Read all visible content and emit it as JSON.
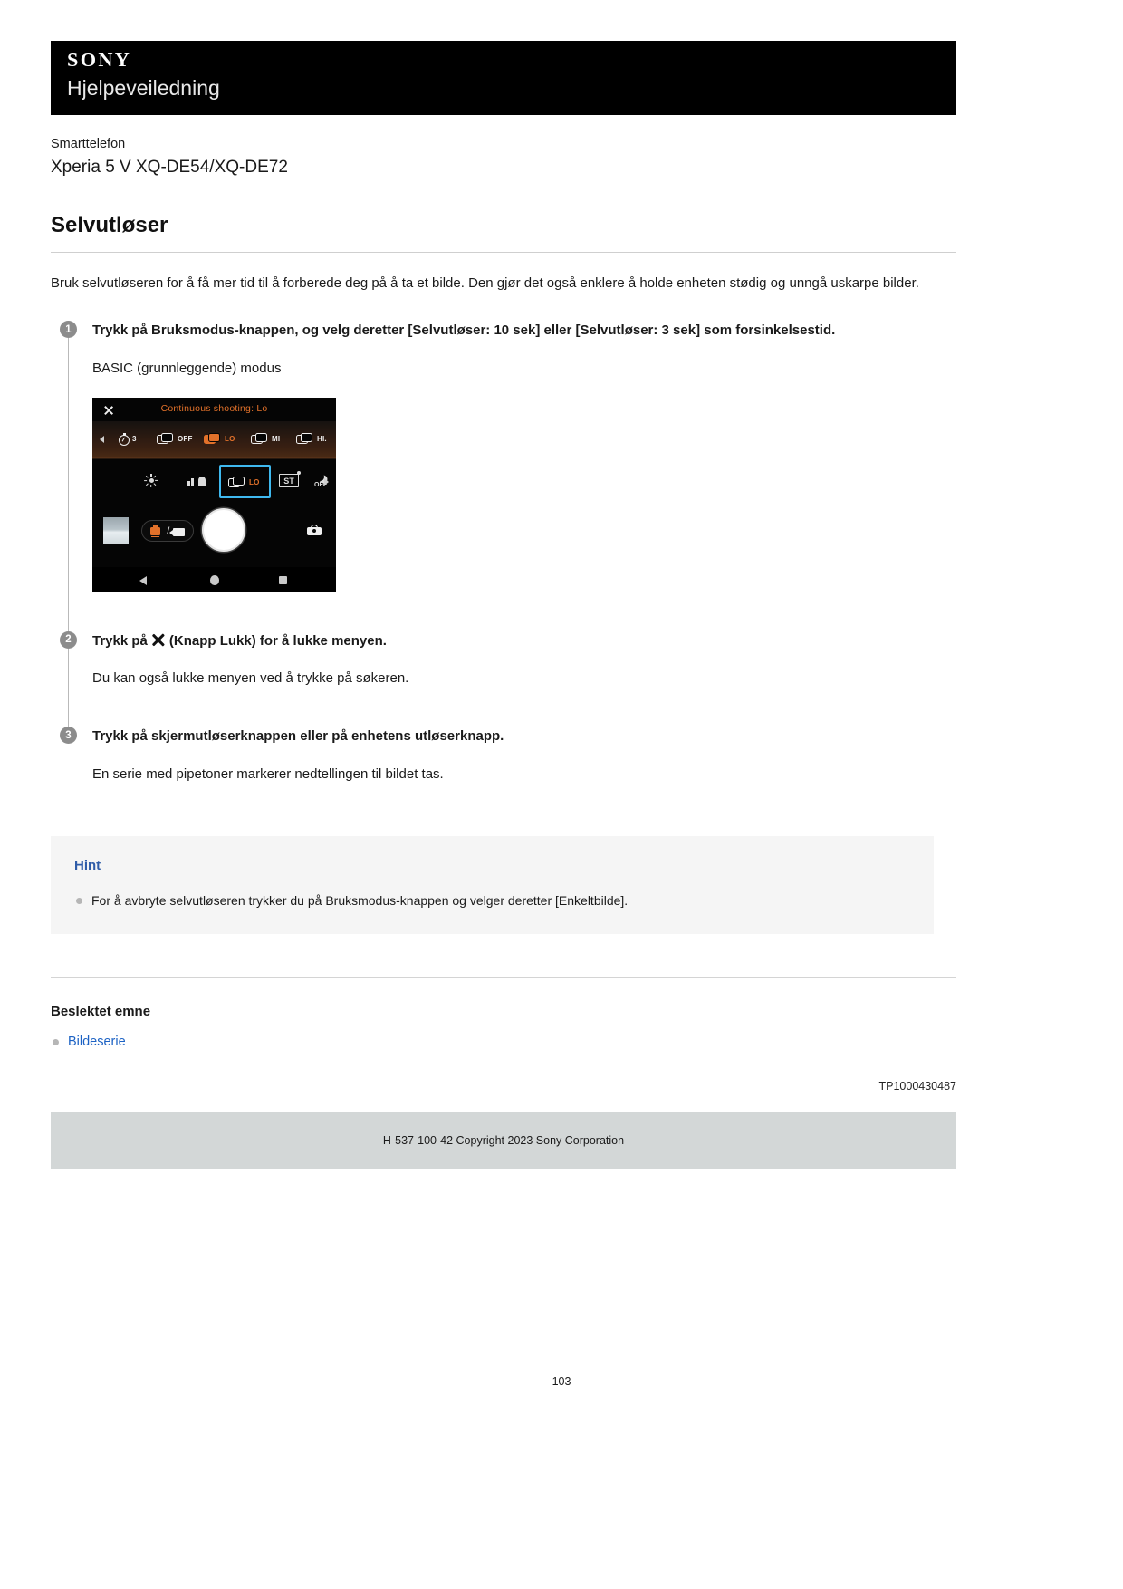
{
  "header": {
    "brand": "SONY",
    "guide_title": "Hjelpeveiledning"
  },
  "product": {
    "category": "Smarttelefon",
    "model": "Xperia 5 V XQ-DE54/XQ-DE72"
  },
  "doc": {
    "title": "Selvutløser",
    "intro": "Bruk selvutløseren for å få mer tid til å forberede deg på å ta et bilde. Den gjør det også enklere å holde enheten stødig og unngå uskarpe bilder."
  },
  "steps": [
    {
      "number": "1",
      "title": "Trykk på Bruksmodus-knappen, og velg deretter [Selvutløser: 10 sek] eller [Selvutløser: 3 sek] som forsinkelsestid.",
      "body": "BASIC (grunnleggende) modus"
    },
    {
      "number": "2",
      "title_before": "Trykk på",
      "title_after": "(Knapp Lukk) for å lukke menyen.",
      "body": "Du kan også lukke menyen ved å trykke på søkeren."
    },
    {
      "number": "3",
      "title": "Trykk på skjermutløserknappen eller på enhetens utløserknapp.",
      "body": "En serie med pipetoner markerer nedtellingen til bildet tas."
    }
  ],
  "camera_shot": {
    "mode_label": "Continuous shooting: Lo",
    "close_icon": "close-icon",
    "top_row": [
      {
        "icon": "self-timer-icon",
        "label": "3",
        "selected": false
      },
      {
        "icon": "drive-mode-icon",
        "label": "OFF",
        "selected": false
      },
      {
        "icon": "drive-mode-icon",
        "label": "LO",
        "selected": true
      },
      {
        "icon": "drive-mode-icon",
        "label": "MI",
        "selected": false
      },
      {
        "icon": "drive-mode-icon",
        "label": "HI.",
        "selected": false
      }
    ],
    "bottom_row": [
      {
        "icon": "white-balance-icon",
        "label": ""
      },
      {
        "icon": "scene-recognition-icon",
        "label": ""
      },
      {
        "icon": "drive-mode-icon",
        "label": "LO",
        "selected": true
      },
      {
        "icon": "self-timer-st-icon",
        "label": "ST"
      },
      {
        "icon": "night-mode-icon",
        "label": "OFF"
      }
    ],
    "controls": {
      "thumbnail": "gallery-thumbnail",
      "mode_toggle": "photo-video-toggle",
      "shutter": "shutter-button",
      "switch_camera": "switch-camera-icon"
    },
    "nav_bar": [
      "back-button",
      "home-button",
      "recents-button"
    ]
  },
  "hint": {
    "title": "Hint",
    "items": [
      "For å avbryte selvutløseren trykker du på Bruksmodus-knappen og velger deretter [Enkeltbilde]."
    ]
  },
  "related": {
    "title": "Beslektet emne",
    "links": [
      "Bildeserie"
    ]
  },
  "footer": {
    "doc_id": "TP1000430487",
    "copyright": "H-537-100-42 Copyright 2023 Sony Corporation",
    "page_number": "103"
  },
  "colors": {
    "accent_orange": "#e2712a",
    "selection_blue": "#3fb9ef",
    "link_blue": "#1c62c4",
    "hint_blue": "#2f5ca8",
    "header_black": "#000000"
  }
}
